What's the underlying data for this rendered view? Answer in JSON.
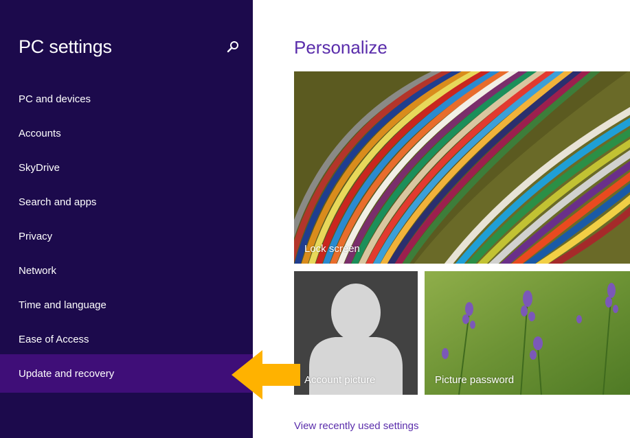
{
  "sidebar": {
    "title": "PC settings",
    "search_icon": "search-icon",
    "items": [
      {
        "label": "PC and devices"
      },
      {
        "label": "Accounts"
      },
      {
        "label": "SkyDrive"
      },
      {
        "label": "Search and apps"
      },
      {
        "label": "Privacy"
      },
      {
        "label": "Network"
      },
      {
        "label": "Time and language"
      },
      {
        "label": "Ease of Access"
      },
      {
        "label": "Update and recovery",
        "selected": true
      }
    ]
  },
  "main": {
    "title": "Personalize",
    "tiles": {
      "lock_screen": "Lock screen",
      "account_picture": "Account picture",
      "picture_password": "Picture password"
    },
    "recent_link": "View recently used settings"
  },
  "colors": {
    "sidebar_bg": "#1c0a4c",
    "selected_bg": "#3f0e78",
    "accent": "#5a2dab",
    "arrow": "#ffb200"
  }
}
